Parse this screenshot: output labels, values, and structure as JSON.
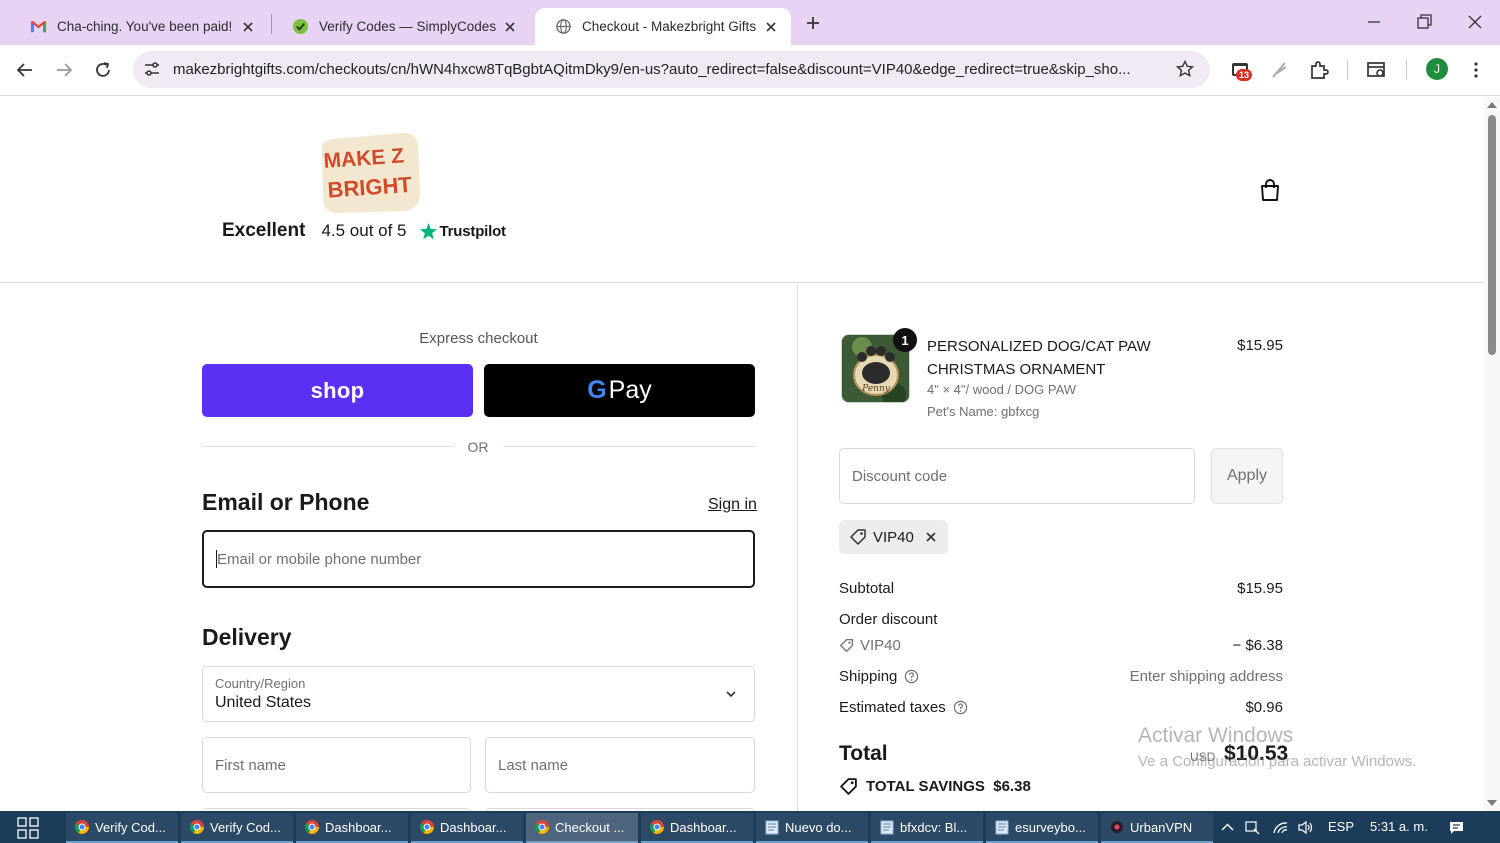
{
  "browser": {
    "tabs": [
      {
        "title": "Cha-ching. You've been paid! -",
        "icon": "gmail-icon",
        "active": false
      },
      {
        "title": "Verify Codes — SimplyCodes",
        "icon": "simplycodes-icon",
        "active": false
      },
      {
        "title": "Checkout - Makezbright Gifts",
        "icon": "globe-icon",
        "active": true
      }
    ],
    "url": "makezbrightgifts.com/checkouts/cn/hWN4hxcw8TqBgbtAQitmDky9/en-us?auto_redirect=false&discount=VIP40&edge_redirect=true&skip_sho...",
    "extensions_badge": "13",
    "profile_initial": "J"
  },
  "header": {
    "logo_text_1": "MAKE Z",
    "logo_text_2": "BRIGHT",
    "rating_word": "Excellent",
    "rating_score": "4.5 out of 5",
    "rating_source": "Trustpilot"
  },
  "checkout": {
    "express_label": "Express checkout",
    "shop_pay_label": "shop",
    "gpay_g": "G",
    "gpay_label": "Pay",
    "or_label": "OR",
    "contact_title": "Email or Phone",
    "sign_in": "Sign in",
    "email_placeholder": "Email or mobile phone number",
    "delivery_title": "Delivery",
    "country_label": "Country/Region",
    "country_value": "United States",
    "first_name_placeholder": "First name",
    "last_name_placeholder": "Last name"
  },
  "summary": {
    "product": {
      "quantity": "1",
      "name": "PERSONALIZED DOG/CAT PAW CHRISTMAS ORNAMENT",
      "variant": "4\" × 4\"/ wood / DOG PAW",
      "pet_name": "Pet's Name: gbfxcg",
      "price": "$15.95",
      "image_caption": "Penny"
    },
    "discount_placeholder": "Discount code",
    "apply_label": "Apply",
    "applied_code": "VIP40",
    "subtotal_label": "Subtotal",
    "subtotal_value": "$15.95",
    "order_discount_label": "Order discount",
    "discount_code": "VIP40",
    "discount_value": "− $6.38",
    "shipping_label": "Shipping",
    "shipping_value": "Enter shipping address",
    "taxes_label": "Estimated taxes",
    "taxes_value": "$0.96",
    "total_label": "Total",
    "total_currency": "USD",
    "total_value": "$10.53",
    "savings_label": "TOTAL SAVINGS",
    "savings_value": "$6.38"
  },
  "watermark": {
    "line1": "Activar Windows",
    "line2": "Ve a Configuración para activar Windows."
  },
  "taskbar": {
    "items": [
      {
        "label": "Verify Cod...",
        "icon": "chrome-icon"
      },
      {
        "label": "Verify Cod...",
        "icon": "chrome-icon"
      },
      {
        "label": "Dashboar...",
        "icon": "chrome-icon"
      },
      {
        "label": "Dashboar...",
        "icon": "chrome-icon"
      },
      {
        "label": "Checkout ...",
        "icon": "chrome-icon"
      },
      {
        "label": "Dashboar...",
        "icon": "chrome-icon"
      },
      {
        "label": "Nuevo do...",
        "icon": "notepad-icon"
      },
      {
        "label": "bfxdcv: Bl...",
        "icon": "notepad-icon"
      },
      {
        "label": "esurveybo...",
        "icon": "notepad-icon"
      },
      {
        "label": "UrbanVPN",
        "icon": "urbanvpn-icon"
      }
    ],
    "language": "ESP",
    "time": "5:31 a. m."
  },
  "colors": {
    "tabstrip": "#e8d3f5",
    "shop_pay": "#5a31f4",
    "trustpilot_green": "#00b67a",
    "taskbar": "#1c3c5a"
  }
}
